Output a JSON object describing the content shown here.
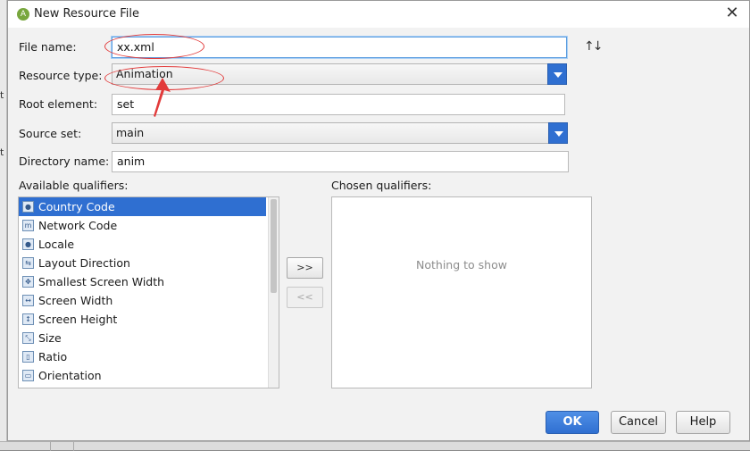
{
  "title": "New Resource File",
  "fields": {
    "file_name": {
      "label": "File name:",
      "value": "xx.xml"
    },
    "resource_type": {
      "label": "Resource type:",
      "value": "Animation"
    },
    "root_element": {
      "label": "Root element:",
      "value": "set"
    },
    "source_set": {
      "label": "Source set:",
      "value": "main"
    },
    "directory_name": {
      "label": "Directory name:",
      "value": "anim"
    }
  },
  "available": {
    "label": "Available qualifiers:",
    "items": [
      {
        "label": "Country Code",
        "icon": "globe-icon",
        "selected": true
      },
      {
        "label": "Network Code",
        "icon": "network-icon"
      },
      {
        "label": "Locale",
        "icon": "globe-icon"
      },
      {
        "label": "Layout Direction",
        "icon": "layout-direction-icon"
      },
      {
        "label": "Smallest Screen Width",
        "icon": "screen-width-icon"
      },
      {
        "label": "Screen Width",
        "icon": "screen-width-icon"
      },
      {
        "label": "Screen Height",
        "icon": "screen-height-icon"
      },
      {
        "label": "Size",
        "icon": "size-icon"
      },
      {
        "label": "Ratio",
        "icon": "ratio-icon"
      },
      {
        "label": "Orientation",
        "icon": "orientation-icon"
      }
    ]
  },
  "move_buttons": {
    "add": ">>",
    "remove": "<<"
  },
  "chosen": {
    "label": "Chosen qualifiers:",
    "empty_text": "Nothing to show"
  },
  "buttons": {
    "ok": "OK",
    "cancel": "Cancel",
    "help": "Help"
  },
  "background": {
    "side_chars": [
      "t",
      "t"
    ]
  },
  "colors": {
    "accent": "#2f6fd1",
    "annotation": "#e23b3b"
  }
}
